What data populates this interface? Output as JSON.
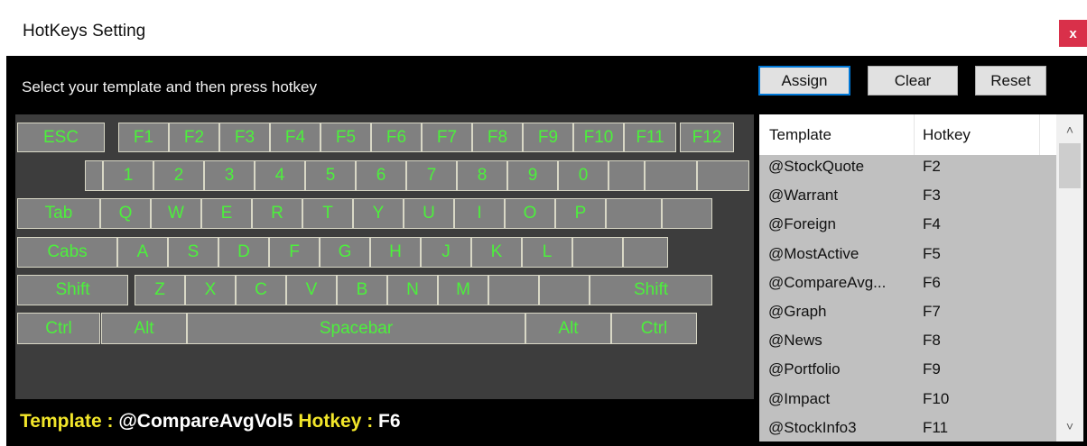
{
  "window": {
    "title": "HotKeys Setting",
    "close_label": "x"
  },
  "instruction": "Select your template and then press hotkey",
  "buttons": {
    "assign": "Assign",
    "clear": "Clear",
    "reset": "Reset"
  },
  "keyboard": {
    "rows": [
      [
        "ESC",
        "F1",
        "F2",
        "F3",
        "F4",
        "F5",
        "F6",
        "F7",
        "F8",
        "F9",
        "F10",
        "F11",
        "F12"
      ],
      [
        "",
        "1",
        "2",
        "3",
        "4",
        "5",
        "6",
        "7",
        "8",
        "9",
        "0",
        "",
        "",
        ""
      ],
      [
        "Tab",
        "Q",
        "W",
        "E",
        "R",
        "T",
        "Y",
        "U",
        "I",
        "O",
        "P",
        "",
        ""
      ],
      [
        "Cabs",
        "A",
        "S",
        "D",
        "F",
        "G",
        "H",
        "J",
        "K",
        "L",
        "",
        ""
      ],
      [
        "Shift",
        "Z",
        "X",
        "C",
        "V",
        "B",
        "N",
        "M",
        "",
        "",
        "Shift"
      ],
      [
        "Ctrl",
        "Alt",
        "Spacebar",
        "Alt",
        "Ctrl"
      ]
    ]
  },
  "status": {
    "template_label": "Template :",
    "template_value": "@CompareAvgVol5",
    "hotkey_label": "Hotkey :",
    "hotkey_value": "F6"
  },
  "list": {
    "headers": [
      "Template",
      "Hotkey"
    ],
    "rows": [
      {
        "template": "@StockQuote",
        "hotkey": "F2"
      },
      {
        "template": "@Warrant",
        "hotkey": "F3"
      },
      {
        "template": "@Foreign",
        "hotkey": "F4"
      },
      {
        "template": "@MostActive",
        "hotkey": "F5"
      },
      {
        "template": "@CompareAvg...",
        "hotkey": "F6"
      },
      {
        "template": "@Graph",
        "hotkey": "F7"
      },
      {
        "template": "@News",
        "hotkey": "F8"
      },
      {
        "template": "@Portfolio",
        "hotkey": "F9"
      },
      {
        "template": "@Impact",
        "hotkey": "F10"
      },
      {
        "template": "@StockInfo3",
        "hotkey": "F11"
      }
    ]
  },
  "icons": {
    "scroll_up": "chevron-up-icon",
    "scroll_down": "chevron-down-icon"
  },
  "colors": {
    "key_text": "#4cf03c",
    "label_yellow": "#f2e62a",
    "close_red": "#d9304a"
  }
}
